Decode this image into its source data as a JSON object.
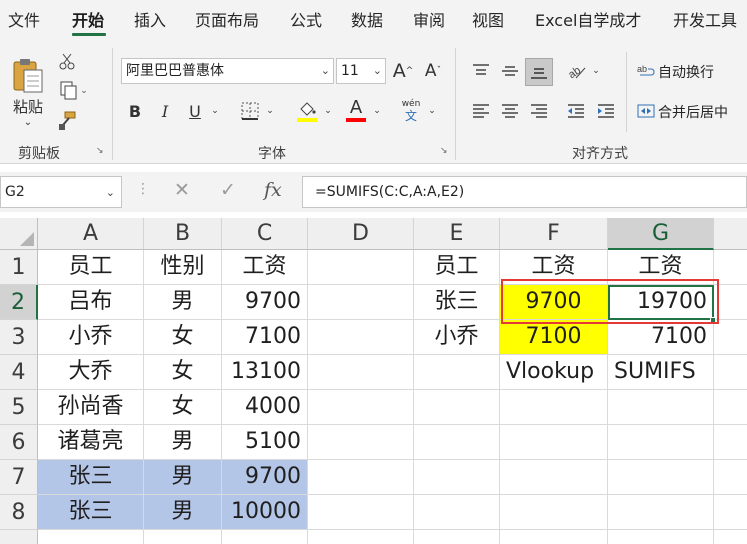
{
  "menu": {
    "tabs": [
      "文件",
      "开始",
      "插入",
      "页面布局",
      "公式",
      "数据",
      "审阅",
      "视图",
      "Excel自学成才",
      "开发工具"
    ],
    "active": "开始"
  },
  "ribbon": {
    "clipboard": {
      "paste_label": "粘贴",
      "group_label": "剪贴板"
    },
    "font": {
      "font_name": "阿里巴巴普惠体",
      "font_size": "11",
      "grow": "A",
      "shrink": "A",
      "bold": "B",
      "italic": "I",
      "underline": "U",
      "font_color_glyph": "A",
      "phonetic_top": "wén",
      "phonetic_bottom": "文",
      "group_label": "字体",
      "fill_color": "#ffff00",
      "font_color": "#ff0000"
    },
    "alignment": {
      "wrap_text": "自动换行",
      "merge_center": "合并后居中",
      "group_label": "对齐方式"
    }
  },
  "formula_bar": {
    "name_box": "G2",
    "fx": "fx",
    "formula": "=SUMIFS(C:C,A:A,E2)"
  },
  "sheet": {
    "columns": [
      "A",
      "B",
      "C",
      "D",
      "E",
      "F",
      "G"
    ],
    "rows": [
      "1",
      "2",
      "3",
      "4",
      "5",
      "6",
      "7",
      "8"
    ],
    "cells": {
      "A1": "员工",
      "B1": "性别",
      "C1": "工资",
      "E1": "员工",
      "F1": "工资",
      "G1": "工资",
      "A2": "吕布",
      "B2": "男",
      "C2": "9700",
      "E2": "张三",
      "F2": "9700",
      "G2": "19700",
      "A3": "小乔",
      "B3": "女",
      "C3": "7100",
      "E3": "小乔",
      "F3": "7100",
      "G3": "7100",
      "A4": "大乔",
      "B4": "女",
      "C4": "13100",
      "F4": "Vlookup",
      "G4": "SUMIFS",
      "A5": "孙尚香",
      "B5": "女",
      "C5": "4000",
      "A6": "诸葛亮",
      "B6": "男",
      "C6": "5100",
      "A7": "张三",
      "B7": "男",
      "C7": "9700",
      "A8": "张三",
      "B8": "男",
      "C8": "10000"
    },
    "active_cell": "G2",
    "highlight_yellow": "#ffff00",
    "highlight_blue": "#b4c6e7",
    "annotation_box_color": "#e53935"
  }
}
